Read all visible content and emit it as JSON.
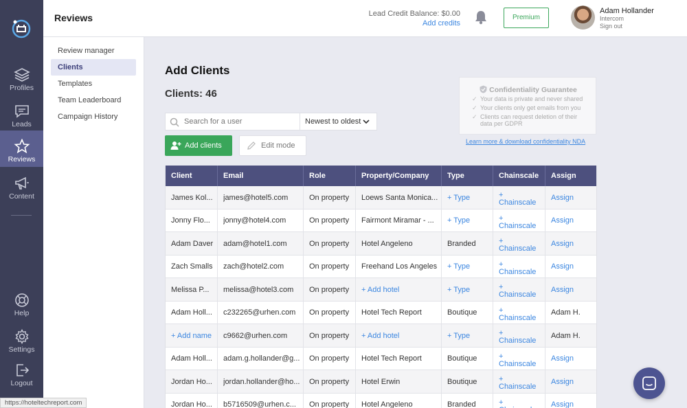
{
  "nav": {
    "items": [
      {
        "label": "Profiles",
        "icon": "layers-icon"
      },
      {
        "label": "Leads",
        "icon": "chat-icon"
      },
      {
        "label": "Reviews",
        "icon": "star-icon"
      },
      {
        "label": "Content",
        "icon": "megaphone-icon"
      },
      {
        "label": "Help",
        "icon": "lifebuoy-icon"
      },
      {
        "label": "Settings",
        "icon": "gear-icon"
      },
      {
        "label": "Logout",
        "icon": "logout-icon"
      }
    ],
    "active": "Reviews"
  },
  "header": {
    "title": "Reviews",
    "credit_label": "Lead Credit Balance: $0.00",
    "add_credits": "Add credits",
    "premium_label": "Premium",
    "user_name": "Adam Hollander",
    "user_company": "Intercom",
    "sign_out": "Sign out"
  },
  "subnav": {
    "items": [
      "Review manager",
      "Clients",
      "Templates",
      "Team Leaderboard",
      "Campaign History"
    ],
    "active": "Clients"
  },
  "main": {
    "heading": "Add Clients",
    "client_count": "Clients: 46",
    "search_placeholder": "Search for a user",
    "sort_value": "Newest to oldest",
    "add_clients_label": "Add clients",
    "edit_mode_label": "Edit mode"
  },
  "guarantee": {
    "title": "Confidentiality Guarantee",
    "points": [
      "Your data is private and never shared",
      "Your clients only get emails from you",
      "Clients can request deletion of their data per GDPR"
    ],
    "nda_link": "Learn more & download confidentiality NDA"
  },
  "table": {
    "columns": [
      "Client",
      "Email",
      "Role",
      "Property/Company",
      "Type",
      "Chainscale",
      "Assign"
    ],
    "rows": [
      {
        "client": "James Kol...",
        "email": "james@hotel5.com",
        "role": "On property",
        "property": "Loews Santa Monica...",
        "type": "+ Type",
        "chainscale": "+ Chainscale",
        "assign": "Assign"
      },
      {
        "client": "Jonny Flo...",
        "email": "jonny@hotel4.com",
        "role": "On property",
        "property": "Fairmont Miramar - ...",
        "type": "+ Type",
        "chainscale": "+ Chainscale",
        "assign": "Assign"
      },
      {
        "client": "Adam Daver",
        "email": "adam@hotel1.com",
        "role": "On property",
        "property": "Hotel Angeleno",
        "type": "Branded",
        "chainscale": "+ Chainscale",
        "assign": "Assign"
      },
      {
        "client": "Zach Smalls",
        "email": "zach@hotel2.com",
        "role": "On property",
        "property": "Freehand Los Angeles",
        "type": "+ Type",
        "chainscale": "+ Chainscale",
        "assign": "Assign"
      },
      {
        "client": "Melissa P...",
        "email": "melissa@hotel3.com",
        "role": "On property",
        "property": "+ Add hotel",
        "type": "+ Type",
        "chainscale": "+ Chainscale",
        "assign": "Assign"
      },
      {
        "client": "Adam Holl...",
        "email": "c232265@urhen.com",
        "role": "On property",
        "property": "Hotel Tech Report",
        "type": "Boutique",
        "chainscale": "+ Chainscale",
        "assign": "Adam H."
      },
      {
        "client": "+ Add name",
        "email": "c9662@urhen.com",
        "role": "On property",
        "property": "+ Add hotel",
        "type": "+ Type",
        "chainscale": "+ Chainscale",
        "assign": "Adam H."
      },
      {
        "client": "Adam Holl...",
        "email": "adam.g.hollander@g...",
        "role": "On property",
        "property": "Hotel Tech Report",
        "type": "Boutique",
        "chainscale": "+ Chainscale",
        "assign": "Assign"
      },
      {
        "client": "Jordan Ho...",
        "email": "jordan.hollander@ho...",
        "role": "On property",
        "property": "Hotel Erwin",
        "type": "Boutique",
        "chainscale": "+ Chainscale",
        "assign": "Assign"
      },
      {
        "client": "Jordan Ho...",
        "email": "b5716509@urhen.c...",
        "role": "On property",
        "property": "Hotel Angeleno",
        "type": "Branded",
        "chainscale": "+ Chainscale",
        "assign": "Assign"
      }
    ]
  },
  "status_url": "https://hoteltechreport.com",
  "colors": {
    "sidebar": "#3c3f58",
    "active_nav": "#5b5f8f",
    "table_header": "#4d507e",
    "accent_green": "#3aa65a",
    "link_blue": "#3b86e0"
  }
}
